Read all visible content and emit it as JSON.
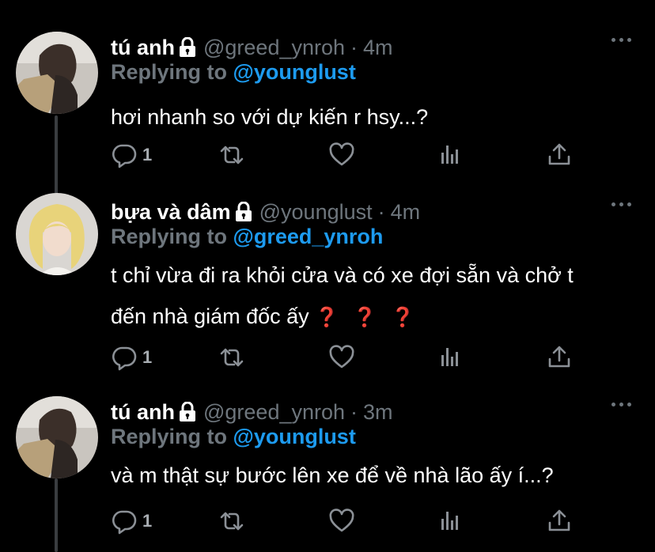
{
  "tweets": [
    {
      "name": "tú anh",
      "handle": "@greed_ynroh",
      "dot": "·",
      "time": "4m",
      "replying_prefix": "Replying to ",
      "replying_to": "@younglust",
      "text_lines": [
        "hơi nhanh so với dự kiến r hsy...?"
      ],
      "reply_count": "1"
    },
    {
      "name": "bựa và dâm",
      "handle": "@younglust",
      "dot": "·",
      "time": "4m",
      "replying_prefix": "Replying to ",
      "replying_to": "@greed_ynroh",
      "text_lines": [
        "t chỉ vừa đi ra khỏi cửa và có xe đợi sẵn và chở t",
        "đến nhà giám đốc ấy"
      ],
      "emoji": [
        "❓",
        "❓",
        "❓"
      ],
      "reply_count": "1"
    },
    {
      "name": "tú anh",
      "handle": "@greed_ynroh",
      "dot": "·",
      "time": "3m",
      "replying_prefix": "Replying to ",
      "replying_to": "@younglust",
      "text_lines": [
        "và m thật sự bước lên xe để về nhà lão ấy í...?"
      ],
      "reply_count": "1"
    }
  ],
  "icons": {
    "lock": "lock-icon",
    "more": "more-icon",
    "reply": "reply-icon",
    "retweet": "retweet-icon",
    "like": "heart-icon",
    "analytics": "analytics-icon",
    "share": "share-icon"
  },
  "colors": {
    "background": "#000000",
    "secondary_text": "#6e767d",
    "mention": "#1d9bf0",
    "thread_line": "#3a3d40",
    "question_mark": "#d9241e"
  }
}
